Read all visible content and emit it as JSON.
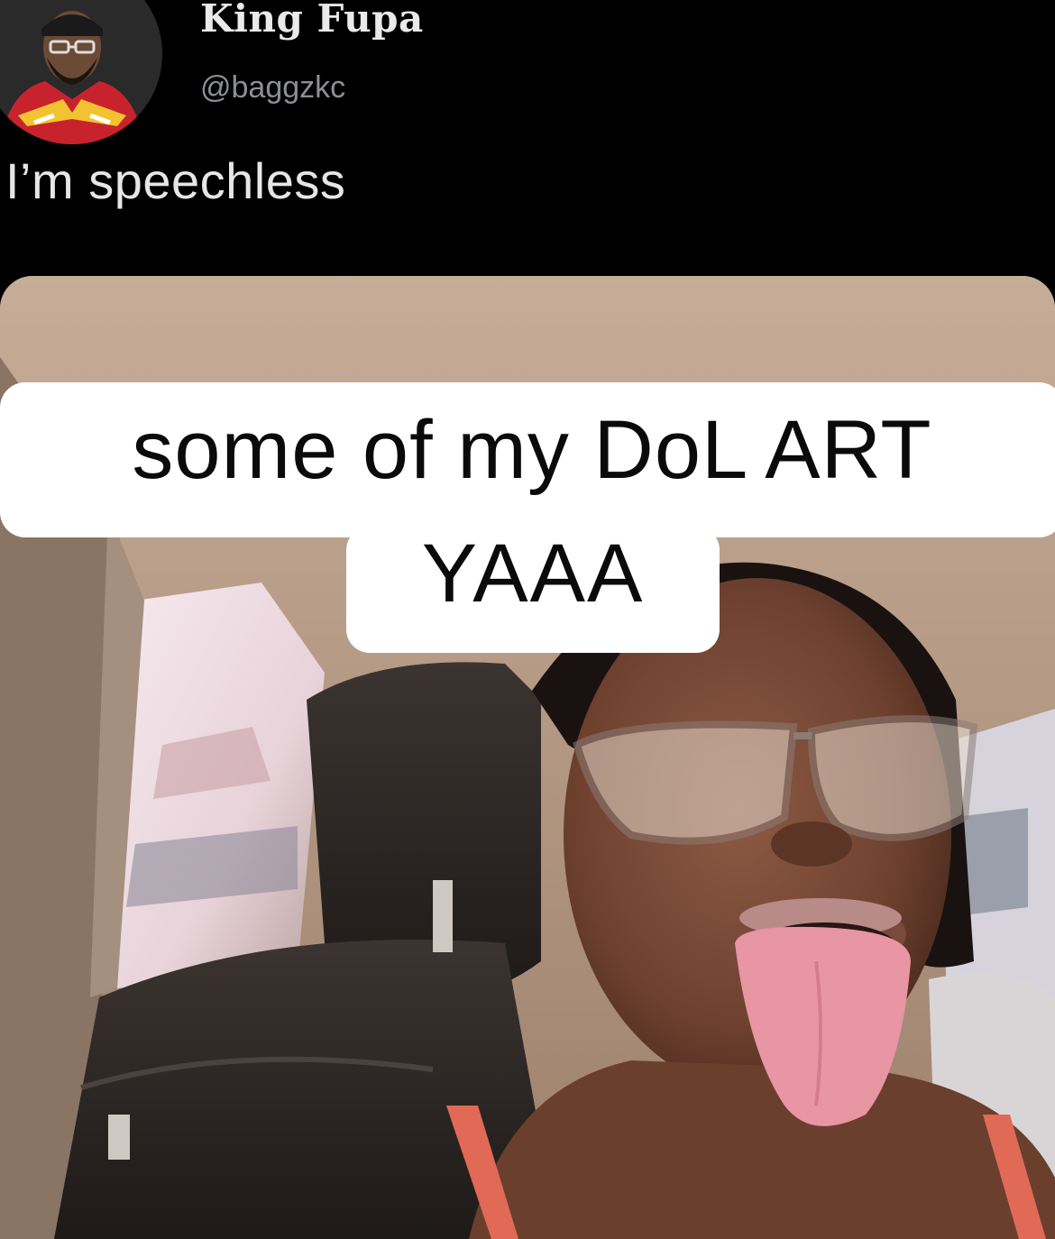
{
  "tweet": {
    "author_name": "King Fupa",
    "author_handle": "@baggzkc",
    "text": "I’m speechless"
  },
  "media": {
    "caption_line1": "some of my DoL ART",
    "caption_line2": "YAAA"
  },
  "colors": {
    "background": "#000000",
    "name_text": "#eaeaea",
    "handle_text": "#8b8f94",
    "caption_bg": "#ffffff",
    "caption_text": "#0a0a0a"
  }
}
